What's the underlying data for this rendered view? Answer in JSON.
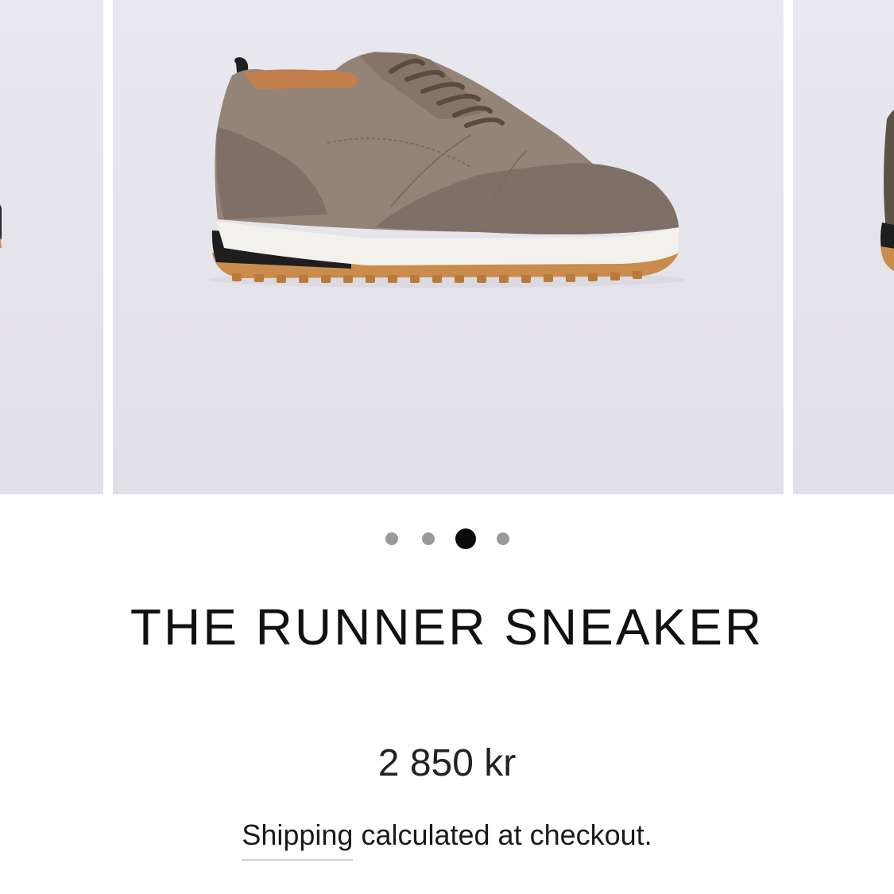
{
  "gallery": {
    "zoom_icon": "search-icon",
    "dots_count": 4,
    "active_dot_index": 2
  },
  "product": {
    "title": "THE RUNNER SNEAKER",
    "price": "2 850 kr",
    "shipping_link": "Shipping",
    "shipping_rest": " calculated at checkout."
  },
  "colors": {
    "background": "#ffffff",
    "image_background": "#e6e5eb",
    "dot_inactive": "#9a9a9a",
    "dot_active": "#0a0a0a",
    "suede": "#7f7067",
    "leather": "#948478",
    "sole_gum": "#c98c4c"
  }
}
